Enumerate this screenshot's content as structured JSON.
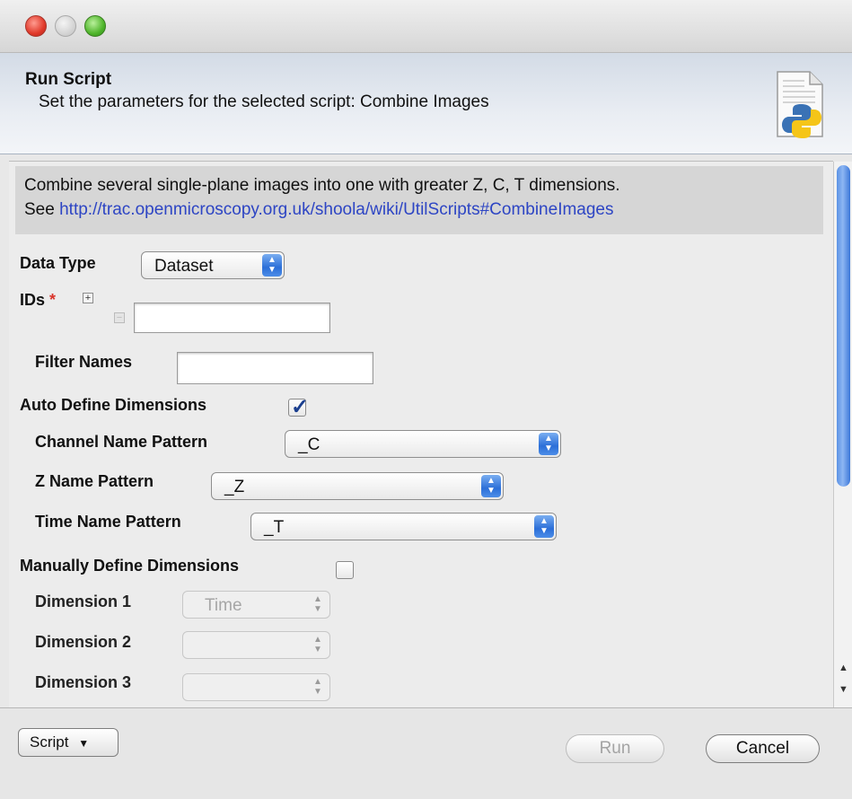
{
  "window": {
    "title_bar_buttons": [
      "close",
      "minimize",
      "zoom"
    ]
  },
  "header": {
    "title": "Run Script",
    "subtitle": "Set the parameters for the selected script: Combine Images",
    "icon": "python-script-icon"
  },
  "description": {
    "line1": "Combine several single-plane images into one with greater Z, C, T dimensions.",
    "see_label": "See ",
    "link": "http://trac.openmicroscopy.org.uk/shoola/wiki/UtilScripts#CombineImages"
  },
  "params": {
    "data_type": {
      "label": "Data Type",
      "value": "Dataset"
    },
    "ids": {
      "label": "IDs",
      "required_mark": "*",
      "add_symbol": "+",
      "remove_symbol": "−",
      "value": ""
    },
    "filter_names": {
      "label": "Filter Names",
      "value": ""
    },
    "auto_define": {
      "label": "Auto Define Dimensions",
      "checked": true
    },
    "channel_pattern": {
      "label": "Channel Name Pattern",
      "value": "_C"
    },
    "z_pattern": {
      "label": "Z Name Pattern",
      "value": "_Z"
    },
    "time_pattern": {
      "label": "Time Name Pattern",
      "value": "_T"
    },
    "manual_define": {
      "label": "Manually Define Dimensions",
      "checked": false
    },
    "dimension1": {
      "label": "Dimension 1",
      "value": "Time"
    },
    "dimension2": {
      "label": "Dimension 2",
      "value": ""
    },
    "dimension3": {
      "label": "Dimension 3",
      "value": ""
    }
  },
  "footer": {
    "script_button": "Script",
    "run_button": "Run",
    "cancel_button": "Cancel"
  },
  "colors": {
    "link": "#2d45c4",
    "accent": "#2c6fd8",
    "required": "#d9342b"
  }
}
